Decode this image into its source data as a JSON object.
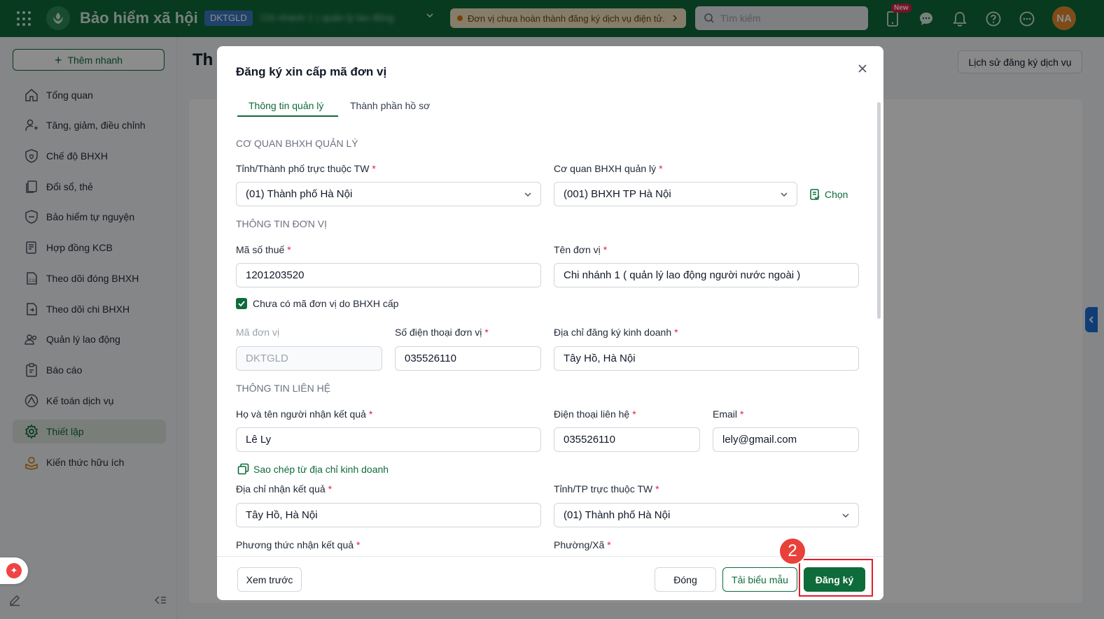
{
  "topbar": {
    "app_title": "Bảo hiểm xã hội",
    "unit_badge": "DKTGLD",
    "unit_name": "Chi nhánh 1 ( quản lý lao động",
    "notice": "Đơn vị chưa hoàn thành đăng ký dịch vụ điện tử.",
    "search_placeholder": "Tìm kiếm",
    "new_badge": "New",
    "avatar": "NA"
  },
  "sidebar": {
    "quick_add": "Thêm nhanh",
    "items": [
      {
        "label": "Tổng quan",
        "icon": "home-icon"
      },
      {
        "label": "Tăng, giảm, điều chỉnh",
        "icon": "user-adjust-icon"
      },
      {
        "label": "Chế độ BHXH",
        "icon": "shield-heart-icon"
      },
      {
        "label": "Đổi sổ, thẻ",
        "icon": "copy-card-icon"
      },
      {
        "label": "Bảo hiểm tự nguyện",
        "icon": "shield-icon"
      },
      {
        "label": "Hợp đồng KCB",
        "icon": "contract-icon"
      },
      {
        "label": "Theo dõi đóng BHXH",
        "icon": "c12-doc-icon"
      },
      {
        "label": "Theo dõi chi BHXH",
        "icon": "doc-payout-icon"
      },
      {
        "label": "Quản lý lao động",
        "icon": "people-icon"
      },
      {
        "label": "Báo cáo",
        "icon": "clipboard-icon"
      },
      {
        "label": "Kế toán dịch vụ",
        "icon": "accounting-icon"
      },
      {
        "label": "Thiết lập",
        "icon": "gear-icon"
      },
      {
        "label": "Kiến thức hữu ích",
        "icon": "knowledge-icon"
      }
    ],
    "active_index": 11
  },
  "page": {
    "title": "Th",
    "history_button": "Lịch sử đăng ký dịch vụ"
  },
  "modal": {
    "title": "Đăng ký xin cấp mã đơn vị",
    "tabs": [
      "Thông tin quản lý",
      "Thành phần hồ sơ"
    ],
    "section_agency": "CƠ QUAN BHXH QUẢN LÝ",
    "province_label": "Tỉnh/Thành phố trực thuộc TW",
    "province_value": "(01) Thành phố Hà Nội",
    "agency_label": "Cơ quan BHXH quản lý",
    "agency_value": "(001) BHXH TP Hà Nội",
    "choose_link": "Chọn",
    "section_unit": "THÔNG TIN ĐƠN VỊ",
    "tax_label": "Mã số thuế",
    "tax_value": "1201203520",
    "unit_name_label": "Tên đơn vị",
    "unit_name_value": "Chi nhánh 1 ( quản lý lao động người nước ngoài )",
    "no_code_checkbox": "Chưa có mã đơn vị do BHXH cấp",
    "unit_code_label": "Mã đơn vị",
    "unit_code_value": "DKTGLD",
    "unit_phone_label": "Số điện thoại đơn vị",
    "unit_phone_value": "035526110",
    "biz_addr_label": "Địa chỉ đăng ký kinh doanh",
    "biz_addr_value": "Tây Hồ, Hà Nội",
    "section_contact": "THÔNG TIN LIÊN HỆ",
    "receiver_label": "Họ và tên người nhận kết quả",
    "receiver_value": "Lê Ly",
    "contact_phone_label": "Điện thoại liên hệ",
    "contact_phone_value": "035526110",
    "email_label": "Email",
    "email_value": "lely@gmail.com",
    "copy_link": "Sao chép từ địa chỉ kinh doanh",
    "receive_addr_label": "Địa chỉ nhận kết quả",
    "receive_addr_value": "Tây Hồ, Hà Nội",
    "receive_province_label": "Tỉnh/TP trực thuộc TW",
    "receive_province_value": "(01) Thành phố Hà Nội",
    "method_label": "Phương thức nhận kết quả",
    "ward_label": "Phường/Xã",
    "buttons": {
      "preview": "Xem trước",
      "close": "Đóng",
      "download_template": "Tải biểu mẫu",
      "register": "Đăng ký"
    }
  },
  "annotation": {
    "step_number": "2"
  },
  "colors": {
    "brand": "#0e6b3a",
    "required": "#e11d48",
    "highlight": "#e11d2a"
  }
}
